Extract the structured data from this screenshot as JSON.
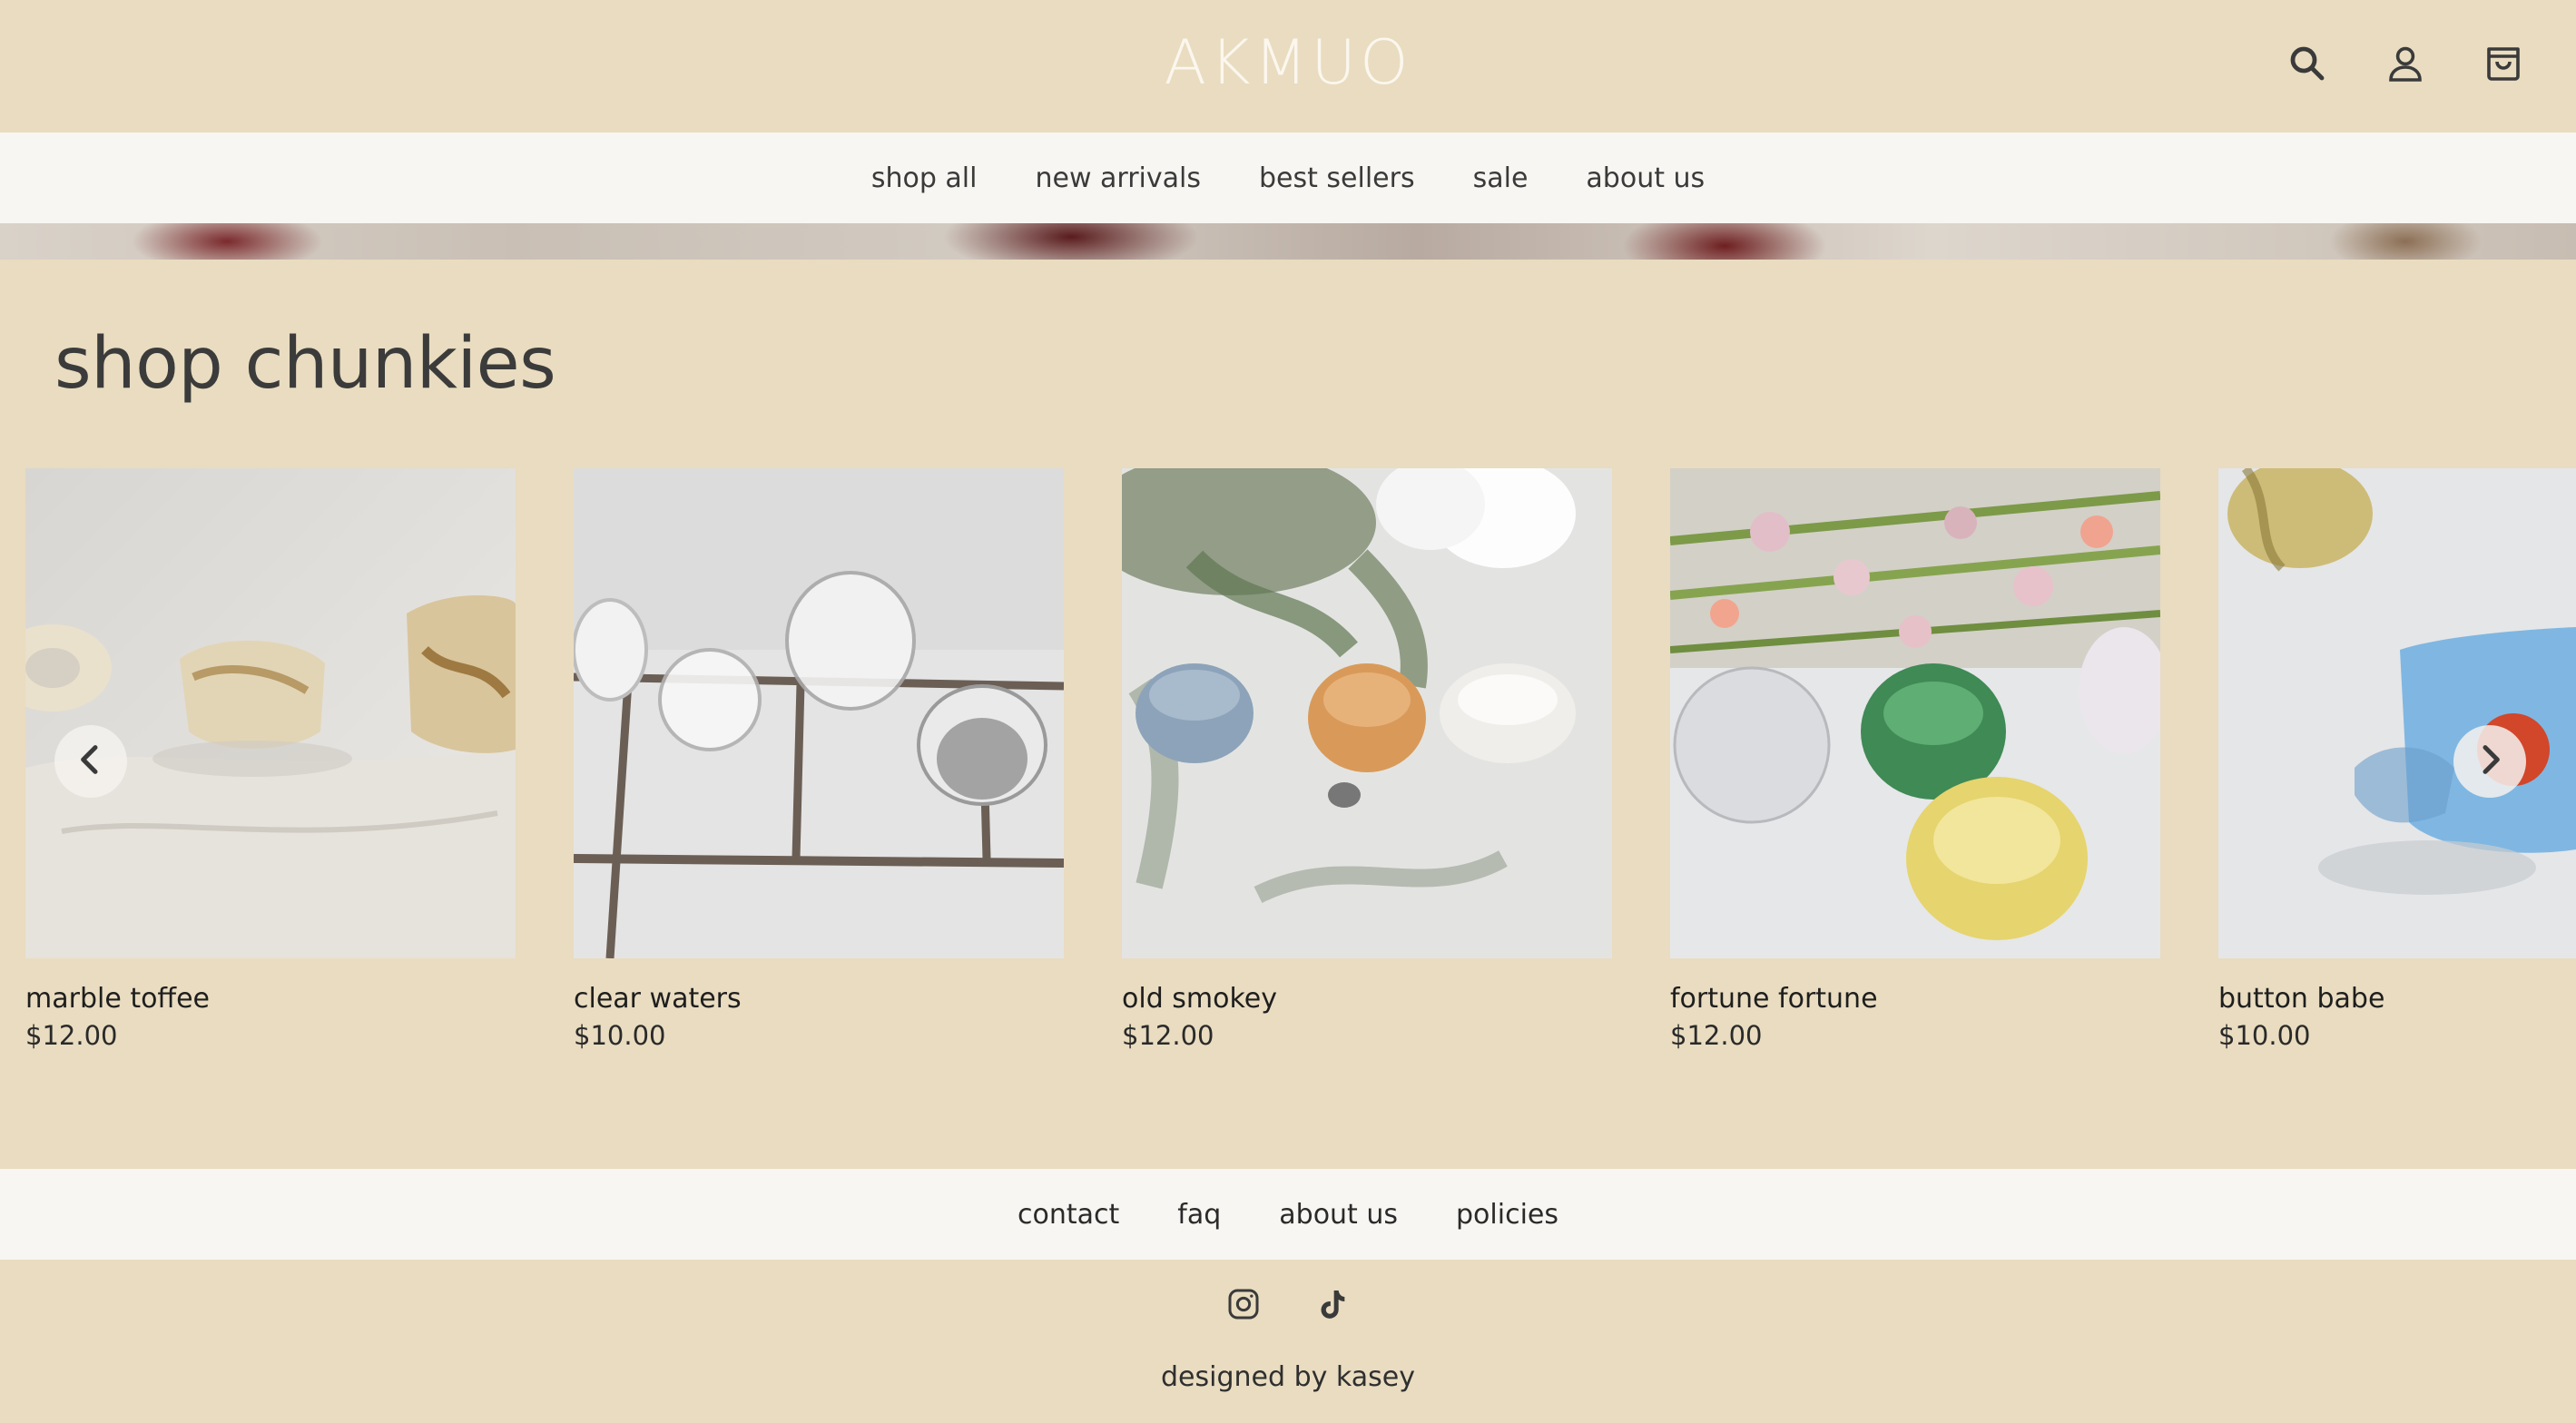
{
  "brand": {
    "logo": "AKMUO"
  },
  "header_icons": [
    "search-icon",
    "account-icon",
    "cart-icon"
  ],
  "nav": {
    "items": [
      {
        "label": "shop all"
      },
      {
        "label": "new arrivals"
      },
      {
        "label": "best sellers"
      },
      {
        "label": "sale"
      },
      {
        "label": "about us"
      }
    ]
  },
  "section": {
    "title": "shop chunkies"
  },
  "products": [
    {
      "name": "marble toffee",
      "price": "$12.00"
    },
    {
      "name": "clear waters",
      "price": "$10.00"
    },
    {
      "name": "old smokey",
      "price": "$12.00"
    },
    {
      "name": "fortune fortune",
      "price": "$12.00"
    },
    {
      "name": "button babe",
      "price": "$10.00"
    }
  ],
  "carousel": {
    "prev_icon": "chevron-left-icon",
    "next_icon": "chevron-right-icon"
  },
  "footer": {
    "links": [
      {
        "label": "contact"
      },
      {
        "label": "faq"
      },
      {
        "label": "about us"
      },
      {
        "label": "policies"
      }
    ],
    "social_icons": [
      "instagram-icon",
      "tiktok-icon"
    ],
    "credit": "designed by kasey"
  },
  "colors": {
    "page_background": "#e9dcc0",
    "nav_background": "#f8f6f2",
    "logo": "#fbf7ee",
    "text": "#2f2f2f"
  }
}
